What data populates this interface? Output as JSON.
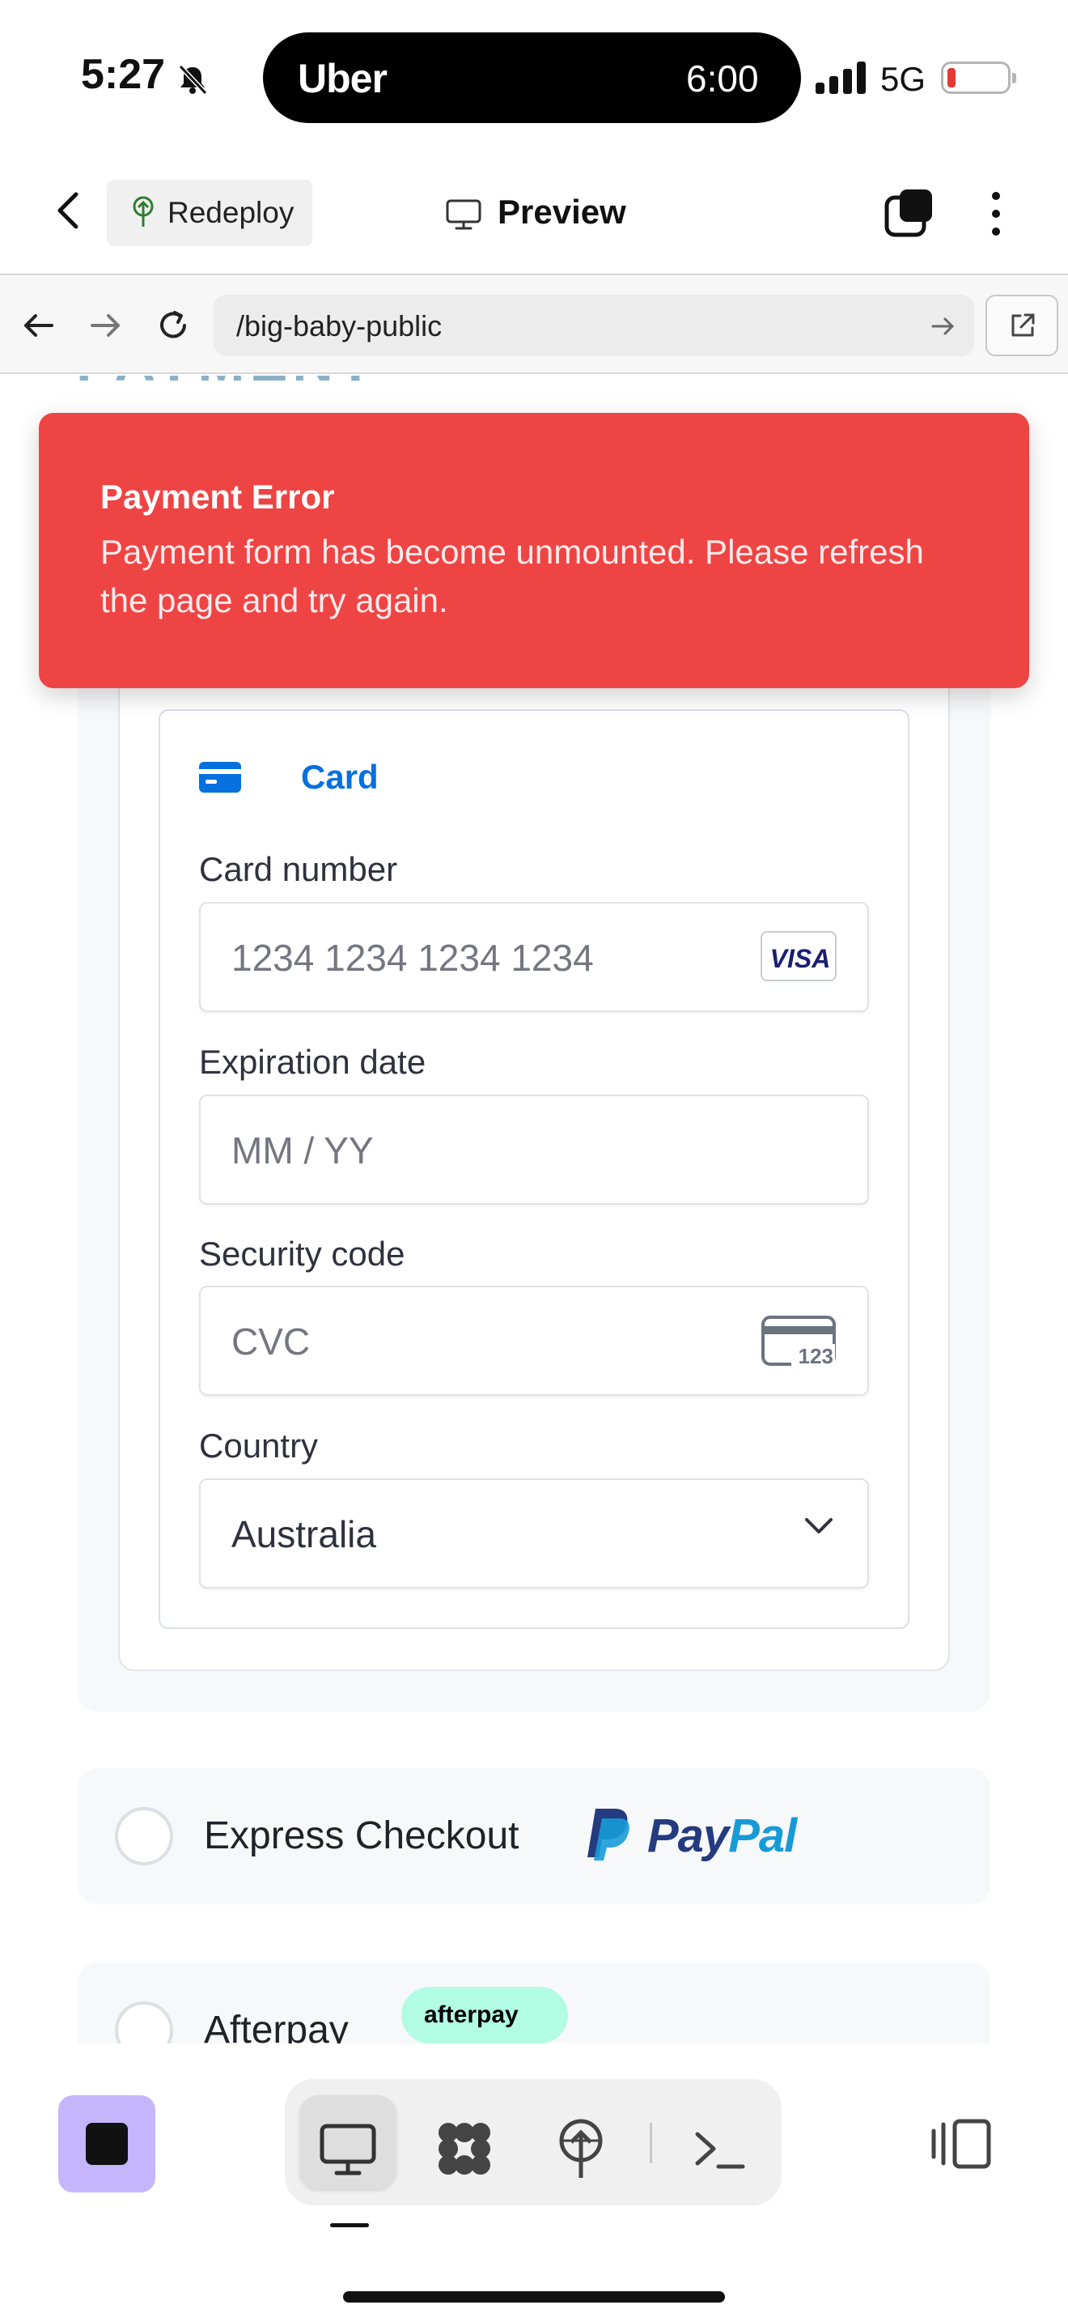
{
  "status_bar": {
    "time": "5:27",
    "live_activity_app": "Uber",
    "live_activity_time": "6:00",
    "network": "5G",
    "icons": [
      "bell-slash-icon",
      "signal-icon",
      "battery-icon"
    ]
  },
  "app_bar": {
    "redeploy_label": "Redeploy",
    "preview_label": "Preview",
    "icons": [
      "chevron-left-icon",
      "deploy-icon",
      "monitor-icon",
      "tabs-icon",
      "more-vertical-icon"
    ]
  },
  "browser": {
    "url": "/big-baby-public",
    "icons": [
      "arrow-left-icon",
      "arrow-right-icon",
      "reload-icon",
      "arrow-right-icon",
      "external-link-icon"
    ]
  },
  "payment": {
    "heading_fragment": "PAYMENT",
    "card_tab_label": "Card",
    "card_number": {
      "label": "Card number",
      "placeholder": "1234 1234 1234 1234",
      "brand": "VISA"
    },
    "expiration": {
      "label": "Expiration date",
      "placeholder": "MM / YY"
    },
    "security": {
      "label": "Security code",
      "placeholder": "CVC",
      "icon_text": "123"
    },
    "country": {
      "label": "Country",
      "value": "Australia"
    },
    "options": [
      {
        "label": "Express Checkout",
        "badge": "PayPal",
        "badge_parts": [
          "Pay",
          "Pal"
        ]
      },
      {
        "label": "Afterpay",
        "badge": "afterpay"
      }
    ]
  },
  "error": {
    "title": "Payment Error",
    "message": "Payment form has become unmounted. Please refresh the page and try again.",
    "color": "#ef4444"
  },
  "toolbar": {
    "active_view": "desktop",
    "icons": [
      "stop-icon",
      "desktop-icon",
      "apps-icon",
      "deploy-icon",
      "terminal-icon",
      "side-panel-icon"
    ],
    "accent": "#c4b5fd"
  }
}
